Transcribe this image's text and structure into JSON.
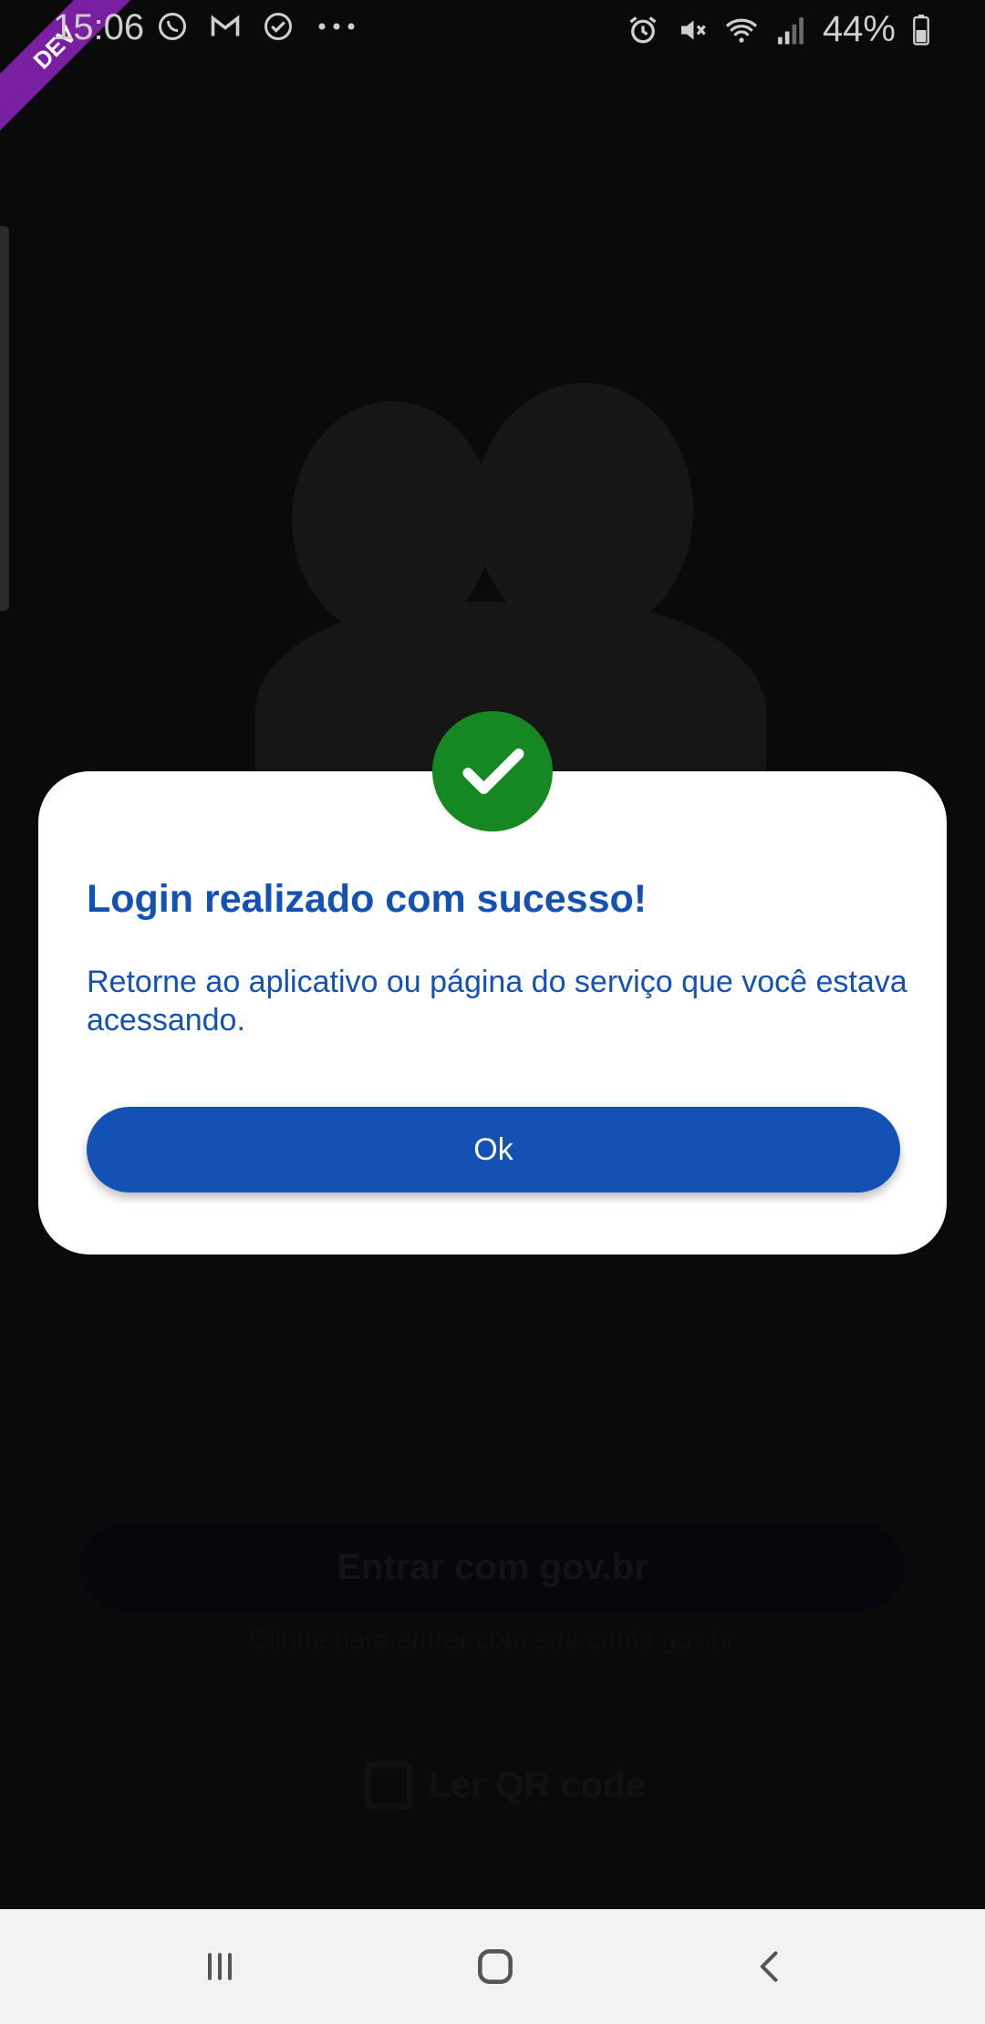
{
  "status_bar": {
    "time": "15:06",
    "left_icons": [
      "whatsapp-icon",
      "gmail-icon",
      "check-circle-icon",
      "more-icon"
    ],
    "right_icons": [
      "alarm-icon",
      "mute-icon",
      "wifi-icon",
      "signal-icon"
    ],
    "battery_percent": "44%"
  },
  "ribbon": {
    "label": "DEV",
    "color": "#7b1fa2"
  },
  "background": {
    "gov_button_label": "Entrar com gov.br",
    "hint_text": "Clique para entrar com sua conta gov.br",
    "qr_label": "Ler QR code"
  },
  "dialog": {
    "title": "Login realizado com sucesso!",
    "message": "Retorne ao aplicativo ou página do serviço que você estava acessando.",
    "ok_label": "Ok",
    "accent_color": "#1351b4",
    "success_color": "#168821"
  },
  "nav_bar": {
    "buttons": [
      "recents-icon",
      "home-icon",
      "back-icon"
    ]
  }
}
